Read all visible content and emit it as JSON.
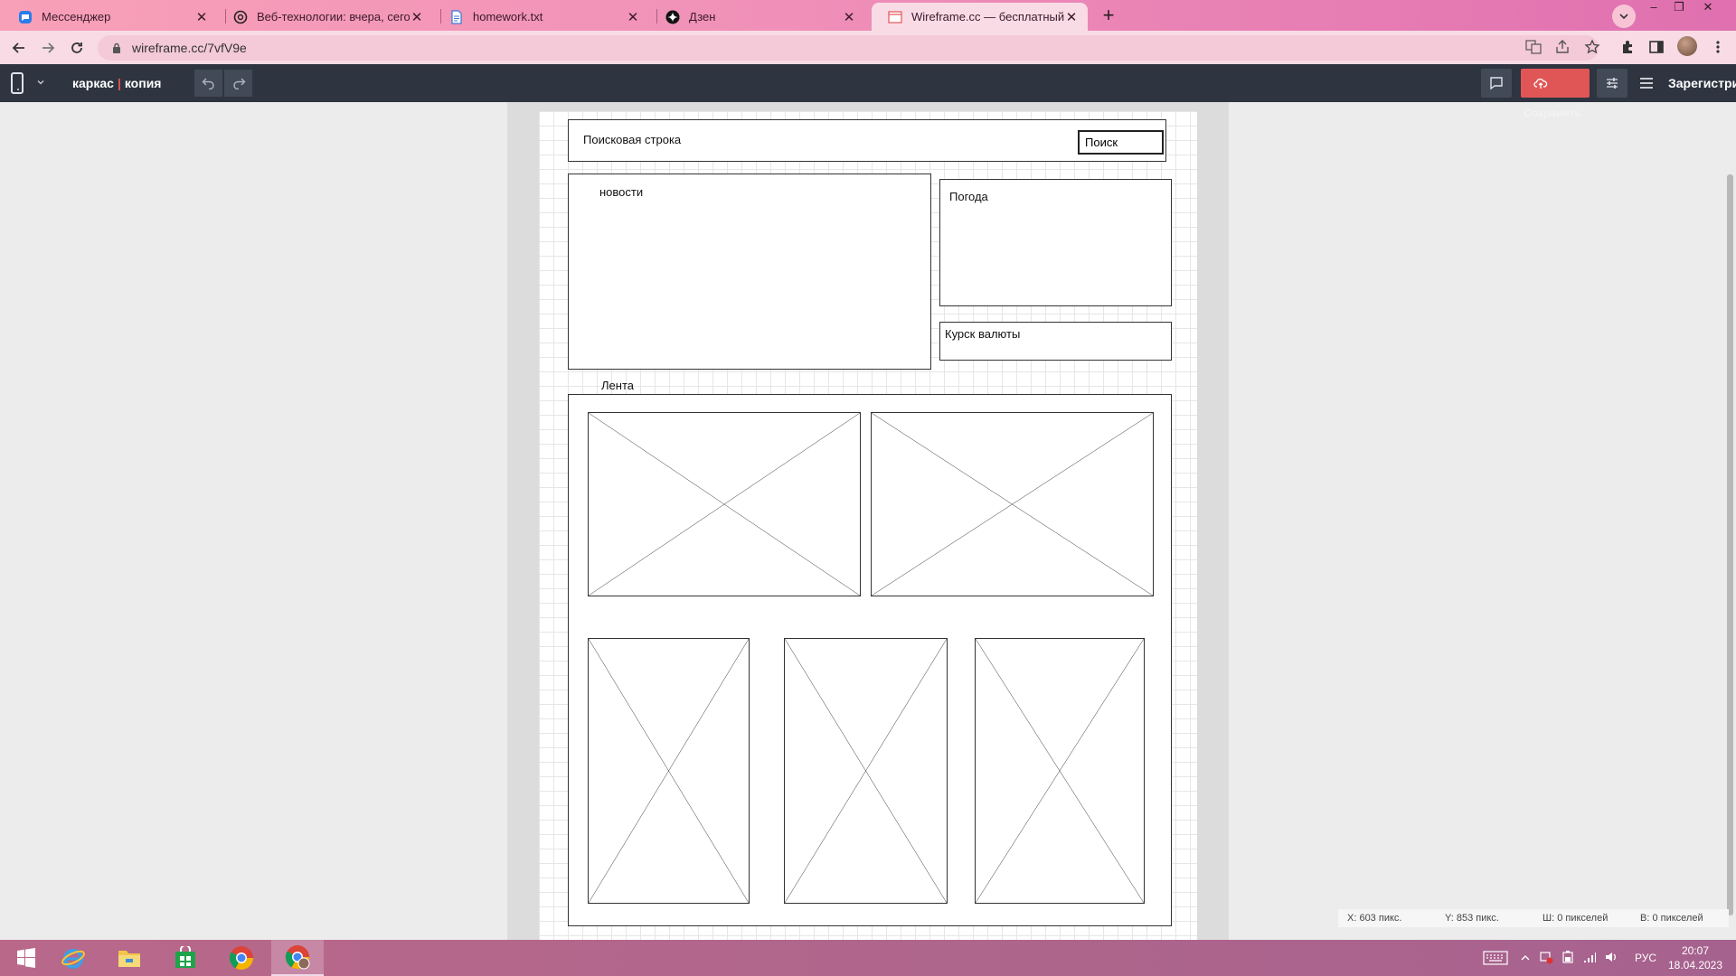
{
  "browser": {
    "tabs": [
      {
        "title": "Мессенджер",
        "icon": "messenger-icon"
      },
      {
        "title": "Веб-технологии: вчера, сегодня",
        "icon": "openai-icon"
      },
      {
        "title": "homework.txt",
        "icon": "document-icon"
      },
      {
        "title": "Дзен",
        "icon": "dzen-icon"
      },
      {
        "title": "Wireframe.cc — бесплатный он",
        "icon": "wireframe-icon",
        "active": true
      }
    ],
    "url": "wireframe.cc/7vfV9e"
  },
  "app": {
    "brand_left": "каркас",
    "brand_right": "копия",
    "save_label": "Сохранять",
    "register_label": "Зарегистри",
    "accent_color": "#e05656",
    "header_color": "#2e3440"
  },
  "wireframe": {
    "search_label": "Поисковая строка",
    "search_field": "Поиск",
    "news_label": "новости",
    "weather_label": "Погода",
    "currency_label": "Курск валюты",
    "feed_label": "Лента"
  },
  "status": {
    "x": "X: 603 пикс.",
    "y": "Y: 853 пикс.",
    "w": "Ш: 0 пикселей",
    "h": "В: 0 пикселей"
  },
  "taskbar": {
    "items": [
      "windows-start-icon",
      "internet-explorer-icon",
      "file-explorer-icon",
      "store-icon",
      "chrome-icon",
      "chrome-profile-icon"
    ],
    "lang": "РУС",
    "time": "20:07",
    "date": "18.04.2023"
  }
}
